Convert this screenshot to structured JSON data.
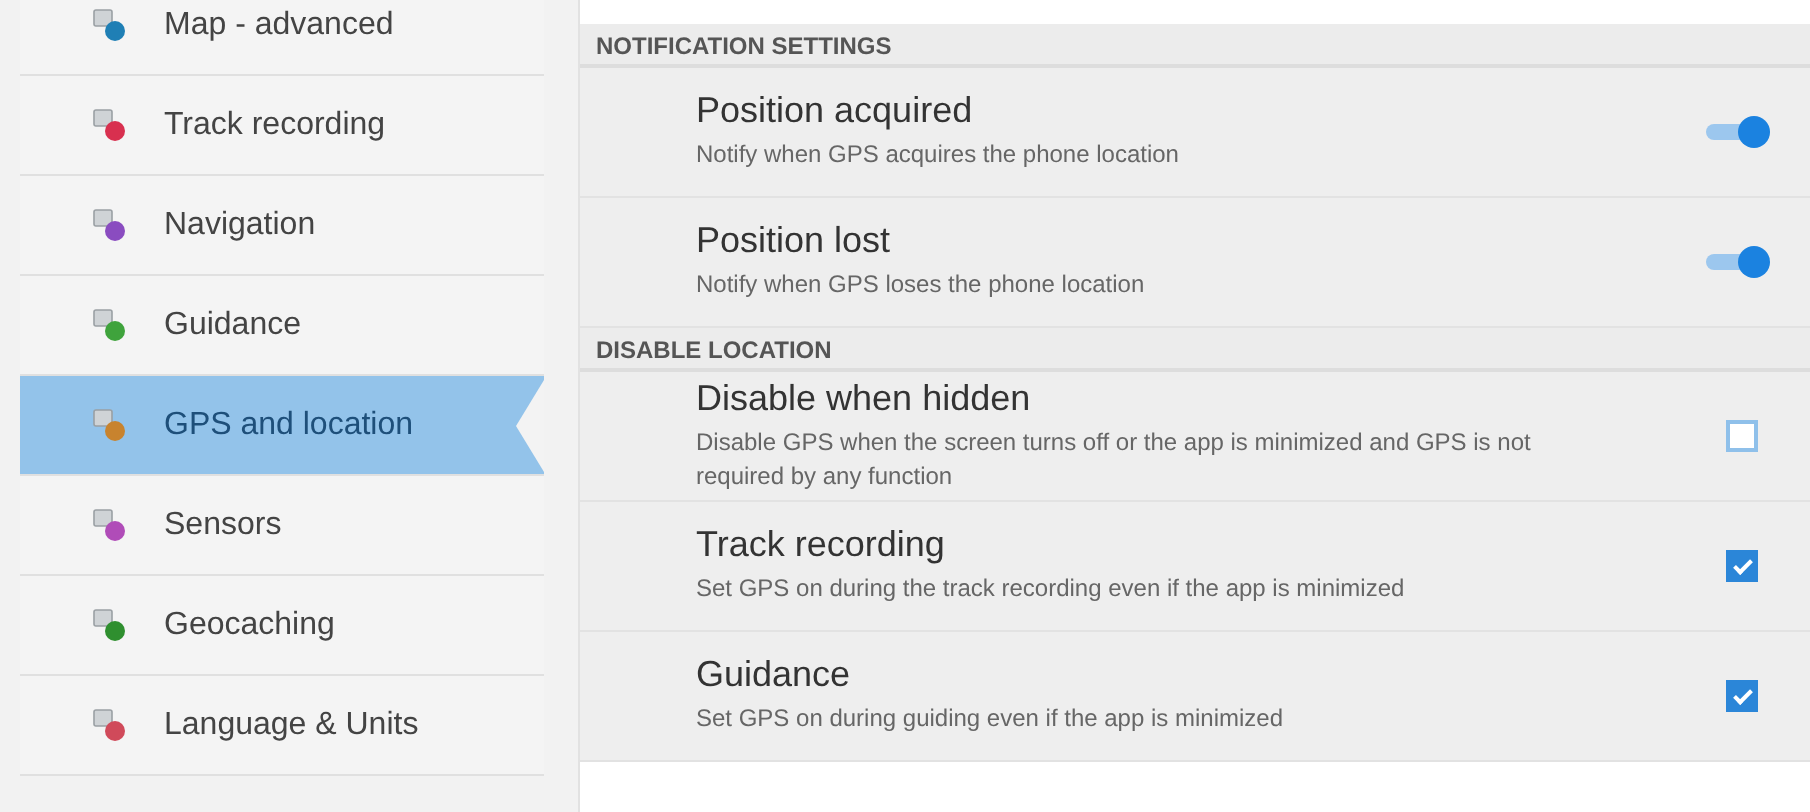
{
  "sidebar": {
    "items": [
      {
        "label": "Map - advanced",
        "selected": false,
        "color": "#1f7fb5"
      },
      {
        "label": "Track recording",
        "selected": false,
        "color": "#d8304f"
      },
      {
        "label": "Navigation",
        "selected": false,
        "color": "#8a4cc0"
      },
      {
        "label": "Guidance",
        "selected": false,
        "color": "#3fa33c"
      },
      {
        "label": "GPS and location",
        "selected": true,
        "color": "#c8832e"
      },
      {
        "label": "Sensors",
        "selected": false,
        "color": "#b04cb8"
      },
      {
        "label": "Geocaching",
        "selected": false,
        "color": "#2f8f2f"
      },
      {
        "label": "Language & Units",
        "selected": false,
        "color": "#d04a5a"
      }
    ]
  },
  "sections": [
    {
      "title": "NOTIFICATION SETTINGS",
      "rows": [
        {
          "kind": "switch",
          "title": "Position acquired",
          "description": "Notify when GPS acquires the phone location",
          "checked": true
        },
        {
          "kind": "switch",
          "title": "Position lost",
          "description": "Notify when GPS loses the phone location",
          "checked": true
        }
      ]
    },
    {
      "title": "DISABLE LOCATION",
      "rows": [
        {
          "kind": "checkbox",
          "title": "Disable when hidden",
          "description": "Disable GPS when the screen turns off or the app is minimized and GPS is not required by any function",
          "checked": false
        },
        {
          "kind": "checkbox",
          "title": "Track recording",
          "description": "Set GPS on during the track recording even if the app is minimized",
          "checked": true
        },
        {
          "kind": "checkbox",
          "title": "Guidance",
          "description": "Set GPS on during guiding even if the app is minimized",
          "checked": true
        }
      ]
    }
  ]
}
